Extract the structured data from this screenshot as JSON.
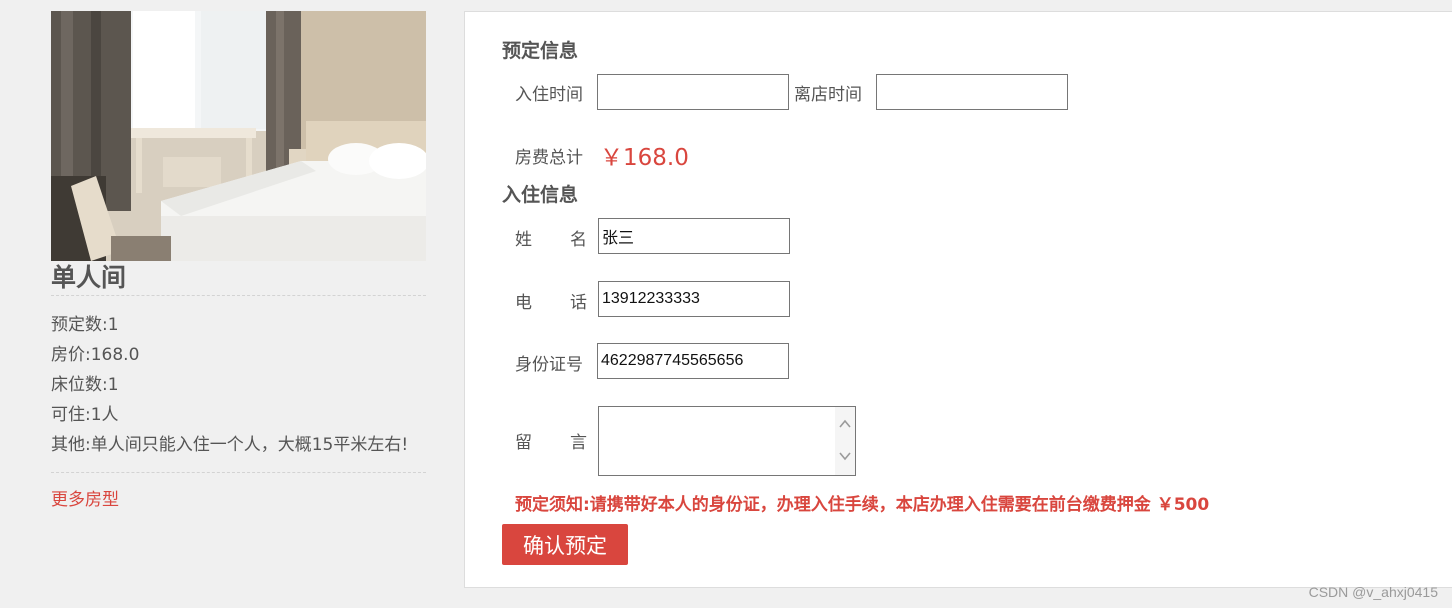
{
  "room": {
    "title": "单人间",
    "info": [
      "预定数:1",
      "房价:168.0",
      "床位数:1",
      "可住:1人",
      "其他:单人间只能入住一个人，大概15平米左右!"
    ],
    "more_link": "更多房型"
  },
  "booking": {
    "section_title": "预定信息",
    "checkin_label": "入住时间",
    "checkin_value": "",
    "checkout_label": "离店时间",
    "checkout_value": "",
    "total_label": "房费总计",
    "total_value": "￥168.0"
  },
  "guest": {
    "section_title": "入住信息",
    "name_label_1": "姓",
    "name_label_2": "名",
    "name_value": "张三",
    "phone_label_1": "电",
    "phone_label_2": "话",
    "phone_value": "13912233333",
    "id_label": "身份证号",
    "id_value": "4622987745565656",
    "message_label_1": "留",
    "message_label_2": "言",
    "message_value": ""
  },
  "notice": "预定须知:请携带好本人的身份证，办理入住手续，本店办理入住需要在前台缴费押金 ￥500",
  "confirm_button": "确认预定",
  "watermark": "CSDN @v_ahxj0415",
  "colors": {
    "accent": "#d9463e",
    "page_bg": "#f0f0f0",
    "panel_bg": "#ffffff",
    "text": "#555555"
  }
}
